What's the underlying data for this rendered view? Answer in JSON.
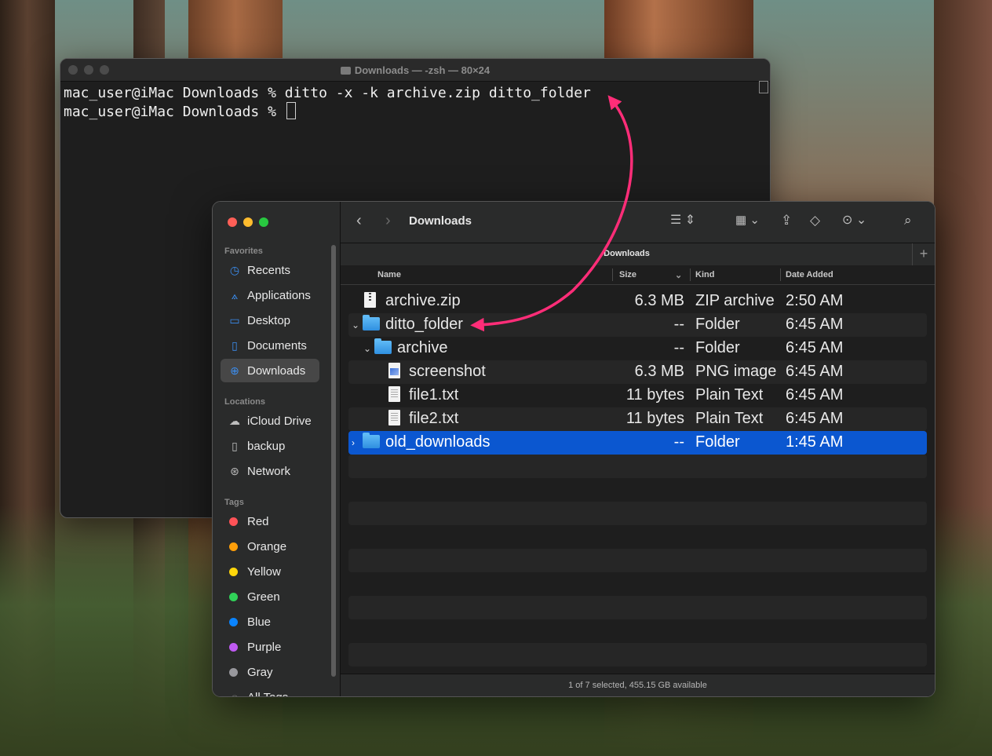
{
  "terminal": {
    "title": "Downloads — -zsh — 80×24",
    "lines": [
      "mac_user@iMac Downloads % ditto -x -k archive.zip ditto_folder",
      "mac_user@iMac Downloads % "
    ]
  },
  "finder": {
    "toolbar": {
      "title": "Downloads"
    },
    "pathbar": {
      "label": "Downloads",
      "plus": "+"
    },
    "columns": {
      "name": "Name",
      "size": "Size",
      "kind": "Kind",
      "date": "Date Added"
    },
    "sidebar": {
      "favorites_header": "Favorites",
      "favorites": [
        "Recents",
        "Applications",
        "Desktop",
        "Documents",
        "Downloads"
      ],
      "locations_header": "Locations",
      "locations": [
        "iCloud Drive",
        "backup",
        "Network"
      ],
      "tags_header": "Tags",
      "tags": [
        {
          "label": "Red",
          "color": "#ff5257"
        },
        {
          "label": "Orange",
          "color": "#ff9f0a"
        },
        {
          "label": "Yellow",
          "color": "#ffd60a"
        },
        {
          "label": "Green",
          "color": "#30d158"
        },
        {
          "label": "Blue",
          "color": "#0a84ff"
        },
        {
          "label": "Purple",
          "color": "#bf5af2"
        },
        {
          "label": "Gray",
          "color": "#98989d"
        }
      ],
      "all_tags": "All Tags..."
    },
    "rows": [
      {
        "name": "archive.zip",
        "size": "6.3 MB",
        "kind": "ZIP archive",
        "date": "2:50 AM",
        "icon": "zip-file-icon"
      },
      {
        "name": "ditto_folder",
        "size": "--",
        "kind": "Folder",
        "date": "6:45 AM",
        "icon": "folder-icon"
      },
      {
        "name": "archive",
        "size": "--",
        "kind": "Folder",
        "date": "6:45 AM",
        "icon": "folder-icon"
      },
      {
        "name": "screenshot",
        "size": "6.3 MB",
        "kind": "PNG image",
        "date": "6:45 AM",
        "icon": "png-file-icon"
      },
      {
        "name": "file1.txt",
        "size": "11 bytes",
        "kind": "Plain Text",
        "date": "6:45 AM",
        "icon": "text-file-icon"
      },
      {
        "name": "file2.txt",
        "size": "11 bytes",
        "kind": "Plain Text",
        "date": "6:45 AM",
        "icon": "text-file-icon"
      },
      {
        "name": "old_downloads",
        "size": "--",
        "kind": "Folder",
        "date": "1:45 AM",
        "icon": "folder-icon"
      }
    ],
    "status": "1 of 7 selected, 455.15 GB available",
    "accent": "#0b57d0",
    "annotation_color": "#ff2d78"
  }
}
